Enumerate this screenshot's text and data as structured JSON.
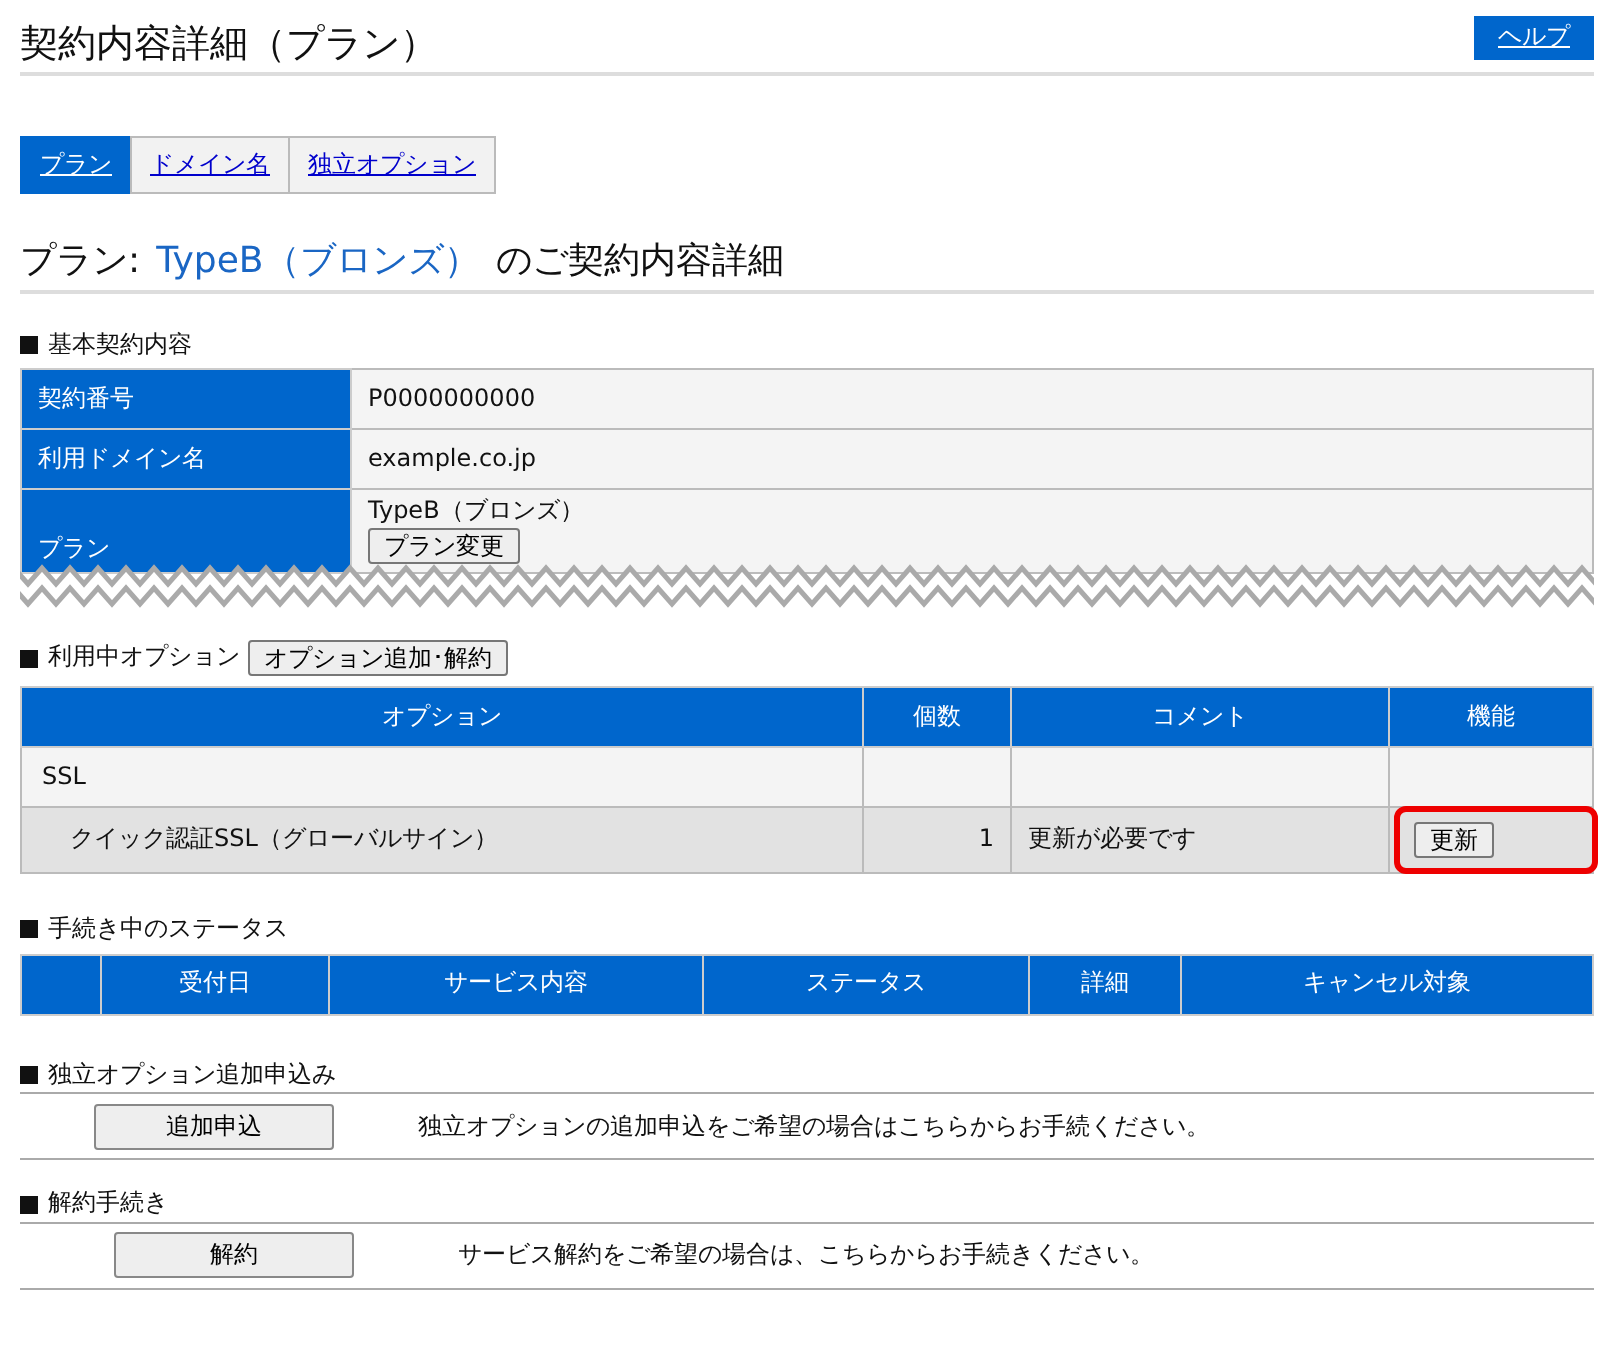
{
  "page_title": "契約内容詳細（プラン）",
  "help_button": "ヘルプ",
  "tabs": [
    {
      "label": "プラン",
      "selected": true
    },
    {
      "label": "ドメイン名",
      "selected": false
    },
    {
      "label": "独立オプション",
      "selected": false
    }
  ],
  "plan_heading": {
    "prefix": "プラン:",
    "plan_name": "TypeB（ブロンズ）",
    "suffix": "のご契約内容詳細"
  },
  "basic_contract": {
    "title": "基本契約内容",
    "rows": [
      {
        "label": "契約番号",
        "value": "P0000000000"
      },
      {
        "label": "利用ドメイン名",
        "value": "example.co.jp"
      },
      {
        "label": "プラン",
        "value": "TypeB（ブロンズ）",
        "button": "プラン変更"
      }
    ],
    "torn_off": true
  },
  "options": {
    "title": "利用中オプション",
    "button": "オプション追加･解約",
    "columns": [
      "オプション",
      "個数",
      "コメント",
      "機能"
    ],
    "rows": [
      {
        "name": "SSL",
        "children": [
          {
            "name": "クイック認証SSL（グローバルサイン）",
            "count": "1",
            "comment": "更新が必要です",
            "action": "更新",
            "highlighted": true
          }
        ]
      }
    ]
  },
  "status": {
    "title": "手続き中のステータス",
    "leading_blank_column": true,
    "columns": [
      "受付日",
      "サービス内容",
      "ステータス",
      "詳細",
      "キャンセル対象"
    ]
  },
  "actions": [
    {
      "title": "独立オプション追加申込み",
      "button": "追加申込",
      "description": "独立オプションの追加申込をご希望の場合はこちらからお手続ください。"
    },
    {
      "title": "解約手続き",
      "button": "解約",
      "description": "サービス解約をご希望の場合は、こちらからお手続きください。"
    }
  ]
}
